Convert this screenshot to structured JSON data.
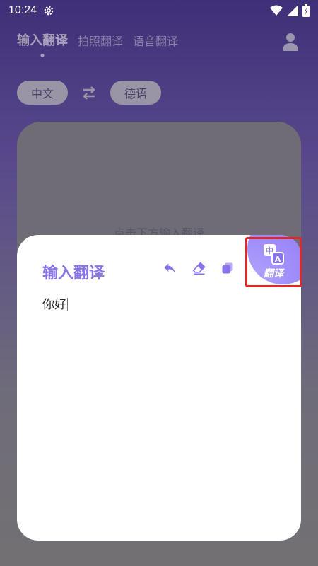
{
  "status_bar": {
    "time": "10:24"
  },
  "tabs": [
    {
      "label": "输入翻译",
      "active": true
    },
    {
      "label": "拍照翻译",
      "active": false
    },
    {
      "label": "语音翻译",
      "active": false
    }
  ],
  "languages": {
    "source": "中文",
    "target": "德语"
  },
  "background_card": {
    "hint": "点击下方输入翻译"
  },
  "sheet": {
    "title": "输入翻译",
    "input_value": "你好",
    "translate_button": {
      "label": "翻译",
      "icon_char_top": "中",
      "icon_char_bottom": "A"
    }
  },
  "colors": {
    "accent": "#8a72ea",
    "highlight": "#e32626"
  },
  "icons": [
    "settings-gear-icon",
    "wifi-icon",
    "signal-icon",
    "battery-icon",
    "user-profile-icon",
    "swap-languages-icon",
    "undo-icon",
    "eraser-icon",
    "copy-icon",
    "translate-icon"
  ]
}
